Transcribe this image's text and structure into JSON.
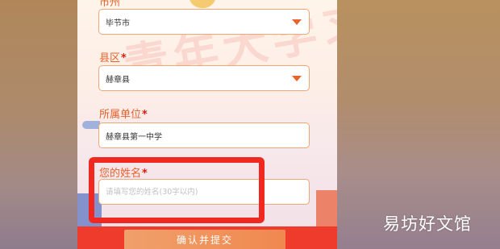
{
  "form": {
    "city": {
      "label": "市州",
      "value": "毕节市"
    },
    "county": {
      "label": "县区",
      "required_mark": "*",
      "value": "赫章县"
    },
    "unit": {
      "label": "所属单位",
      "required_mark": "*",
      "value": "赫章县第一中学"
    },
    "name": {
      "label": "您的姓名",
      "required_mark": "*",
      "placeholder": "请填写您的姓名(30字以内)",
      "value": ""
    },
    "submit_label": "确认并提交"
  },
  "background_text": "青年大学习",
  "site_watermark": "易坊好文馆",
  "colors": {
    "label": "#e6622b",
    "required": "#d81e06",
    "field_border": "#f1a676",
    "highlight": "#f0281f",
    "submit": "#f0884f"
  }
}
